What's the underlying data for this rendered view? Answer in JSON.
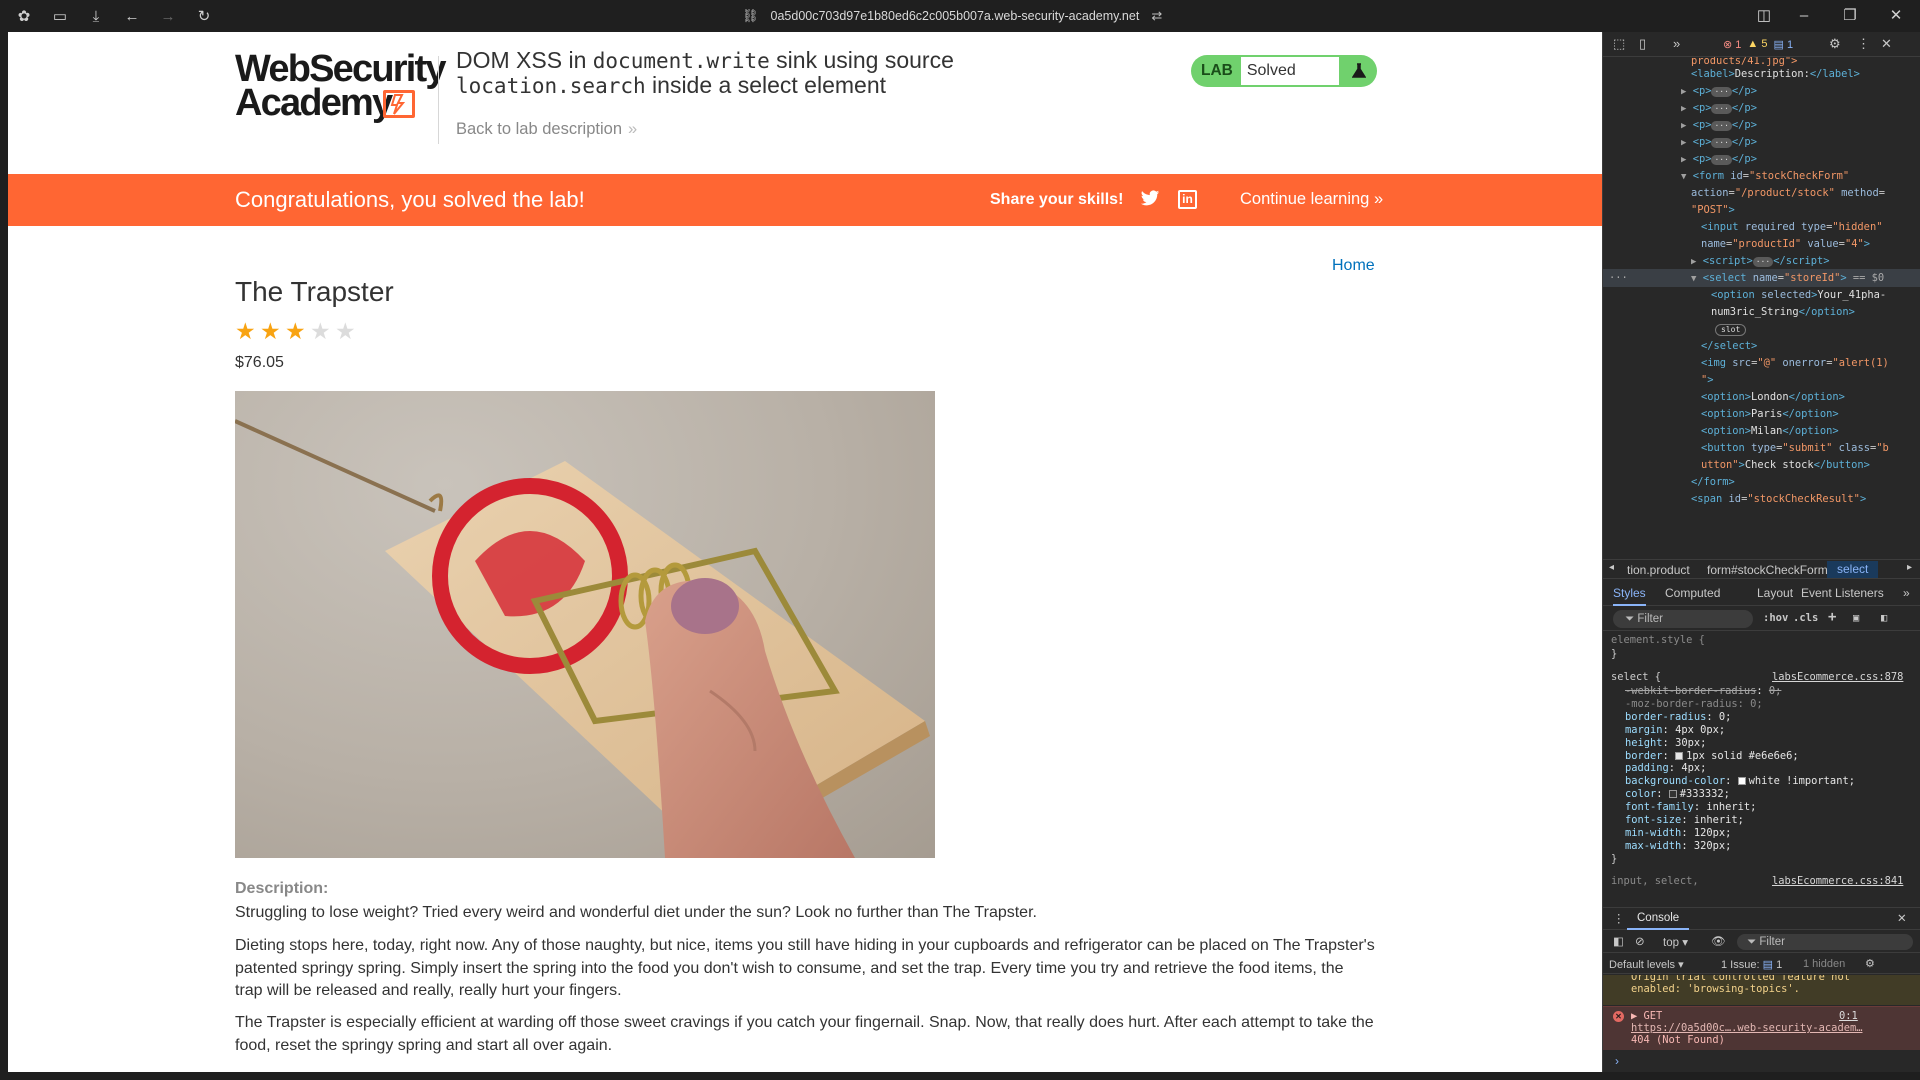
{
  "browser": {
    "url": "0a5d00c703d97e1b80ed6c2c005b007a.web-security-academy.net"
  },
  "header": {
    "logo_line1": "WebSecurity",
    "logo_line2": "Academy",
    "title_part1": "DOM XSS in ",
    "title_code1": "document.write",
    "title_part2": " sink using source",
    "title_code2": "location.search",
    "title_part3": " inside a select element",
    "back_link": "Back to lab description",
    "back_chevrons": "»",
    "status_lab": "LAB",
    "status_value": "Solved",
    "accent_color": "#ff6633",
    "status_color": "#70d16d"
  },
  "banner": {
    "message": "Congratulations, you solved the lab!",
    "share": "Share your skills!",
    "continue": "Continue learning",
    "continue_chevrons": "»"
  },
  "product": {
    "home_link": "Home",
    "title": "The Trapster",
    "rating": 3,
    "rating_max": 5,
    "price": "$76.05",
    "description_label": "Description:",
    "paragraphs": [
      "Struggling to lose weight? Tried every weird and wonderful diet under the sun? Look no further than The Trapster.",
      "Dieting stops here, today, right now. Any of those naughty, but nice, items you still have hiding in your cupboards and refrigerator can be placed on The Trapster's patented springy spring. Simply insert the spring into the food you don't wish to consume, and set the trap. Every time you try and retrieve the food items, the trap will be released and really, really hurt your fingers.",
      "The Trapster is especially efficient at warding off those sweet cravings if you catch your fingernail. Snap. Now, that really does hurt. After each attempt to take the food, reset the springy spring and start all over again."
    ]
  },
  "devtools": {
    "counts": {
      "errors": "1",
      "warnings": "5",
      "info": "1"
    },
    "dom": {
      "l_products": "products/41.jpg\">",
      "label_text": "Description:",
      "form_id": "\"stockCheckForm\"",
      "form_action": "\"/product/stock\"",
      "form_method": "\"POST\"",
      "input_type": "\"hidden\"",
      "input_name": "\"productId\"",
      "input_value": "\"4\"",
      "select_name": "\"storeId\"",
      "selected_marker": "== $0",
      "option1": "Your_41pha-",
      "option1b": "num3ric_String",
      "slot": "slot",
      "img_src": "\"@\"",
      "img_onerror": "\"alert(1)",
      "opt_london": "London",
      "opt_paris": "Paris",
      "opt_milan": "Milan",
      "btn_type": "\"submit\"",
      "btn_class": "\"b",
      "btn_class2": "utton\"",
      "btn_text": "Check stock",
      "span_id": "\"stockCheckResult\""
    },
    "breadcrumbs": [
      "tion.product",
      "form#stockCheckForm",
      "select"
    ],
    "style_tabs": [
      "Styles",
      "Computed",
      "Layout",
      "Event Listeners"
    ],
    "filter_placeholder": "Filter",
    "filter_opts": [
      ":hov",
      ".cls"
    ],
    "styles": {
      "element_style": "element.style {",
      "select_rule": "select {",
      "select_src": "labsEcommerce.css:878",
      "props": [
        {
          "n": "-webkit-border-radius",
          "v": "0;",
          "strike": true
        },
        {
          "n": "-moz-border-radius",
          "v": "0;",
          "dim": true
        },
        {
          "n": "border-radius",
          "v": "0;"
        },
        {
          "n": "margin",
          "v": "4px 0px;"
        },
        {
          "n": "height",
          "v": "30px;"
        },
        {
          "n": "border",
          "v": "1px solid #e6e6e6;"
        },
        {
          "n": "padding",
          "v": "4px;"
        },
        {
          "n": "background-color",
          "v": "white !important;"
        },
        {
          "n": "color",
          "v": "#333332;"
        },
        {
          "n": "font-family",
          "v": "inherit;"
        },
        {
          "n": "font-size",
          "v": "inherit;"
        },
        {
          "n": "min-width",
          "v": "120px;"
        },
        {
          "n": "max-width",
          "v": "320px;"
        }
      ],
      "next_rule": "input, select,",
      "next_src": "labsEcommerce.css:841"
    },
    "console": {
      "tab": "Console",
      "context": "top",
      "filter": "Filter",
      "levels": "Default levels",
      "issues": "1 Issue:",
      "issues_count": "1",
      "hidden": "1 hidden",
      "warn_line1": "Origin trial controlled feature not",
      "warn_line2": "enabled: 'browsing-topics'.",
      "err_method": "GET",
      "err_src": "0:1",
      "err_url": "https://0a5d00c….web-security-academ…",
      "err_status": "404 (Not Found)"
    }
  }
}
